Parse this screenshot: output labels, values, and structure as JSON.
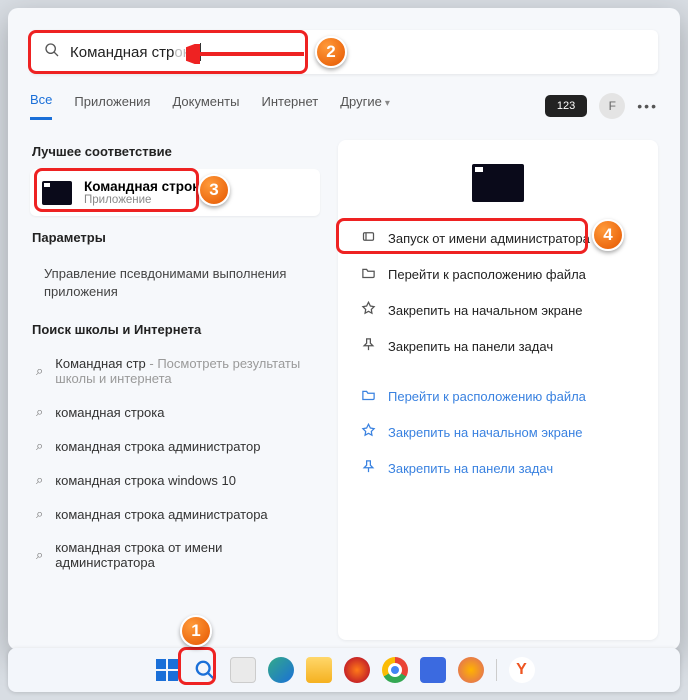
{
  "search": {
    "value_typed": "Командная стр",
    "value_ghost": "ока"
  },
  "tabs": {
    "items": [
      "Все",
      "Приложения",
      "Документы",
      "Интернет",
      "Другие"
    ],
    "active_index": 0,
    "badge": "123",
    "avatar_initial": "F"
  },
  "best_match": {
    "heading": "Лучшее соответствие",
    "title": "Командная строка",
    "subtitle": "Приложение"
  },
  "params": {
    "heading": "Параметры",
    "items": [
      "Управление псевдонимами выполнения приложения"
    ]
  },
  "web": {
    "heading": "Поиск школы и Интернета",
    "suggestions": [
      {
        "text": "Командная стр",
        "hint": " - Посмотреть результаты школы и интернета"
      },
      {
        "text": "командная строка",
        "hint": ""
      },
      {
        "text": "командная строка администратор",
        "hint": ""
      },
      {
        "text": "командная строка windows 10",
        "hint": ""
      },
      {
        "text": "командная строка администратора",
        "hint": ""
      },
      {
        "text": "командная строка от имени администратора",
        "hint": ""
      }
    ]
  },
  "context_menu": {
    "primary": [
      {
        "icon": "admin",
        "label": "Запуск от имени администратора"
      },
      {
        "icon": "folder",
        "label": "Перейти к расположению файла"
      },
      {
        "icon": "pin-start",
        "label": "Закрепить на начальном экране"
      },
      {
        "icon": "pin-task",
        "label": "Закрепить на панели задач"
      }
    ],
    "secondary": [
      {
        "icon": "folder",
        "label": "Перейти к расположению файла"
      },
      {
        "icon": "pin-start",
        "label": "Закрепить на начальном экране"
      },
      {
        "icon": "pin-task",
        "label": "Закрепить на панели задач"
      }
    ]
  },
  "annotations": {
    "n1": "1",
    "n2": "2",
    "n3": "3",
    "n4": "4"
  },
  "colors": {
    "accent": "#1a6fd8",
    "highlight": "#e22"
  }
}
